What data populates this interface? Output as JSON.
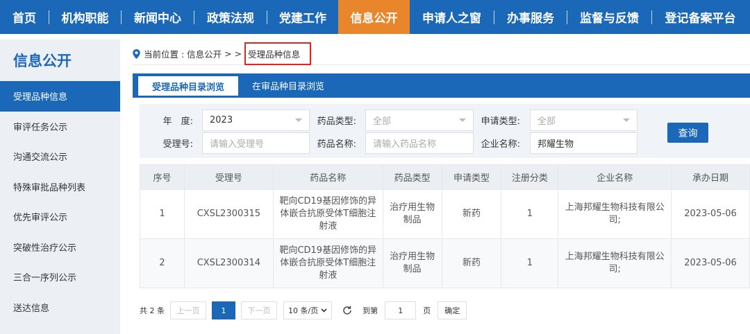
{
  "nav": {
    "items": [
      {
        "label": "首页"
      },
      {
        "label": "机构职能"
      },
      {
        "label": "新闻中心"
      },
      {
        "label": "政策法规"
      },
      {
        "label": "党建工作"
      },
      {
        "label": "信息公开"
      },
      {
        "label": "申请人之窗"
      },
      {
        "label": "办事服务"
      },
      {
        "label": "监督与反馈"
      },
      {
        "label": "登记备案平台"
      }
    ],
    "active_index": 5
  },
  "sidebar": {
    "title": "信息公开",
    "items": [
      {
        "label": "受理品种信息"
      },
      {
        "label": "审评任务公示"
      },
      {
        "label": "沟通交流公示"
      },
      {
        "label": "特殊审批品种列表"
      },
      {
        "label": "优先审评公示"
      },
      {
        "label": "突破性治疗公示"
      },
      {
        "label": "三合一序列公示"
      },
      {
        "label": "送达信息"
      }
    ],
    "active_index": 0
  },
  "breadcrumb": {
    "prefix": "当前位置 : 信息公开",
    "sep1": ">",
    "sep2": ">",
    "current": "受理品种信息"
  },
  "tabs": [
    {
      "label": "受理品种目录浏览"
    },
    {
      "label": "在审品种目录浏览"
    }
  ],
  "filters": {
    "year_label": "年　度:",
    "year_value": "2023",
    "drug_type_label": "药品类型:",
    "drug_type_value": "全部",
    "apply_type_label": "申请类型:",
    "apply_type_value": "全部",
    "accept_no_label": "受理号:",
    "accept_no_placeholder": "请输入受理号",
    "drug_name_label": "药品名称:",
    "drug_name_placeholder": "请输入药品名称",
    "company_label": "企业名称:",
    "company_value": "邦耀生物",
    "query_label": "查询"
  },
  "table": {
    "headers": [
      "序号",
      "受理号",
      "药品名称",
      "药品类型",
      "申请类型",
      "注册分类",
      "企业名称",
      "承办日期"
    ],
    "rows": [
      [
        "1",
        "CXSL2300315",
        "靶向CD19基因修饰的异体嵌合抗原受体T细胞注射液",
        "治疗用生物制品",
        "新药",
        "1",
        "上海邦耀生物科技有限公司;",
        "2023-05-06"
      ],
      [
        "2",
        "CXSL2300314",
        "靶向CD19基因修饰的异体嵌合抗原受体T细胞注射液",
        "治疗用生物制品",
        "新药",
        "1",
        "上海邦耀生物科技有限公司;",
        "2023-05-06"
      ]
    ]
  },
  "pager": {
    "total": "共 2 条",
    "prev": "上一页",
    "current_page": "1",
    "next": "下一页",
    "page_size": "10 条/页",
    "goto_label": "到第",
    "goto_value": "1",
    "page_unit": "页",
    "confirm": "确定"
  },
  "colors": {
    "primary": "#1b67b8",
    "active_nav": "#e9862c",
    "highlight_border": "#e0251f"
  },
  "icons": [
    "location-pin-icon",
    "refresh-icon",
    "chevron-down-icon"
  ]
}
